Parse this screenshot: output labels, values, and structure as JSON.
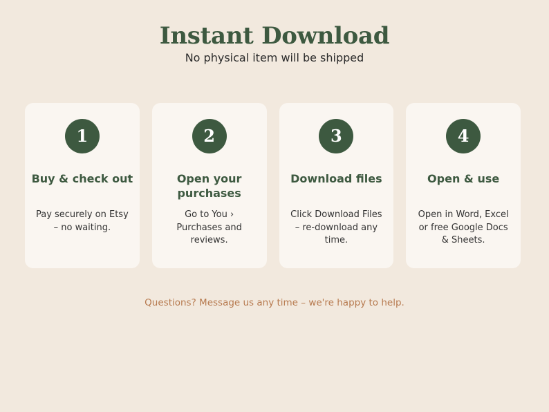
{
  "header": {
    "title": "Instant Download",
    "subtitle": "No physical item will be shipped"
  },
  "steps": [
    {
      "number": "1",
      "title": "Buy & check out",
      "text": "Pay securely on Etsy – no waiting."
    },
    {
      "number": "2",
      "title": "Open your purchases",
      "text": "Go to You › Purchases and reviews."
    },
    {
      "number": "3",
      "title": "Download files",
      "text": "Click Download Files – re-download any time."
    },
    {
      "number": "4",
      "title": "Open & use",
      "text": "Open in Word, Excel or free Google Docs & Sheets."
    }
  ],
  "footer": {
    "text": "Questions? Message us any time – we're happy to help."
  },
  "colors": {
    "background": "#f2e9de",
    "card_background": "#faf6f1",
    "accent_green": "#3d5940",
    "footer_orange": "#b77a4f"
  }
}
